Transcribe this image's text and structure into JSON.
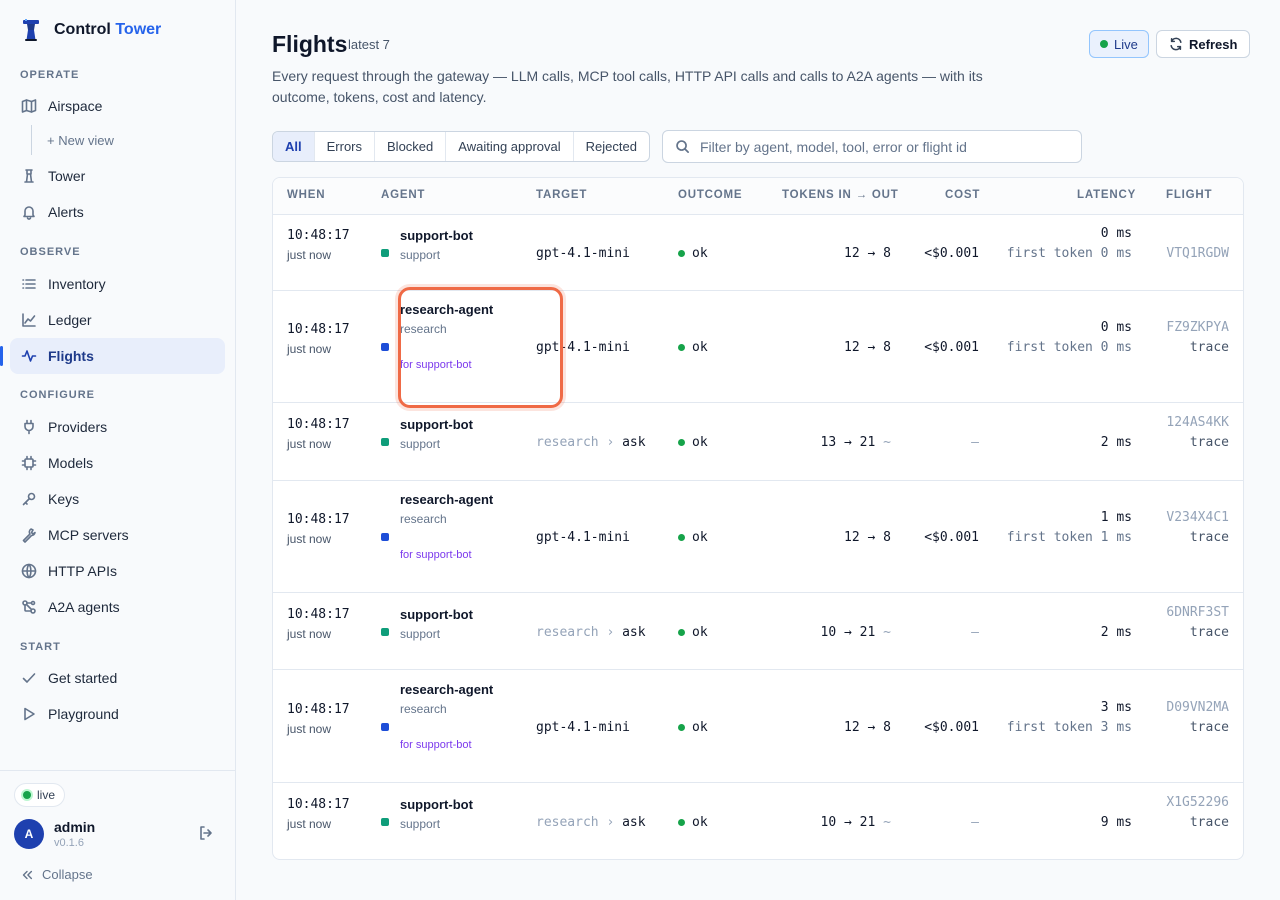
{
  "brand": {
    "name_part1": "Control",
    "name_part2": "Tower"
  },
  "sidebar": {
    "sections": {
      "operate": "OPERATE",
      "observe": "OBSERVE",
      "configure": "CONFIGURE",
      "start": "START"
    },
    "items": {
      "airspace": "Airspace",
      "new_view": "+ New view",
      "tower": "Tower",
      "alerts": "Alerts",
      "inventory": "Inventory",
      "ledger": "Ledger",
      "flights": "Flights",
      "providers": "Providers",
      "models": "Models",
      "keys": "Keys",
      "mcp_servers": "MCP servers",
      "http_apis": "HTTP APIs",
      "a2a_agents": "A2A agents",
      "get_started": "Get started",
      "playground": "Playground"
    },
    "active": "flights",
    "footer": {
      "status": "live",
      "avatar_initial": "A",
      "user": "admin",
      "version": "v0.1.6",
      "collapse": "Collapse"
    }
  },
  "header": {
    "title": "Flights",
    "subtitle": "latest 7",
    "description": "Every request through the gateway — LLM calls, MCP tool calls, HTTP API calls and calls to A2A agents — with its outcome, tokens, cost and latency.",
    "live_label": "Live",
    "refresh_label": "Refresh"
  },
  "filters": {
    "tabs": [
      "All",
      "Errors",
      "Blocked",
      "Awaiting approval",
      "Rejected"
    ],
    "selected": "All",
    "search_placeholder": "Filter by agent, model, tool, error or flight id"
  },
  "table": {
    "columns": [
      "WHEN",
      "AGENT",
      "TARGET",
      "OUTCOME",
      "TOKENS IN → OUT",
      "COST",
      "LATENCY",
      "FLIGHT"
    ],
    "rows": [
      {
        "time": "10:48:17",
        "rel": "just now",
        "agent": "support-bot",
        "team": "support",
        "for": "",
        "swatch": "#0f9d7a",
        "target_prefix": "",
        "target": "gpt-4.1-mini",
        "outcome": "ok",
        "tokens": "12 → 8",
        "tokens_suffix": "",
        "cost": "<$0.001",
        "latency": "0 ms",
        "first_token": "first token 0 ms",
        "flight": "VTQ1RGDW",
        "trace": ""
      },
      {
        "time": "10:48:17",
        "rel": "just now",
        "agent": "research-agent",
        "team": "research",
        "for": "for support-bot",
        "swatch": "#1d4ed8",
        "target_prefix": "",
        "target": "gpt-4.1-mini",
        "outcome": "ok",
        "tokens": "12 → 8",
        "tokens_suffix": "",
        "cost": "<$0.001",
        "latency": "0 ms",
        "first_token": "first token 0 ms",
        "flight": "FZ9ZKPYA",
        "trace": "trace"
      },
      {
        "time": "10:48:17",
        "rel": "just now",
        "agent": "support-bot",
        "team": "support",
        "for": "",
        "swatch": "#0f9d7a",
        "target_prefix": "research ›",
        "target": "ask",
        "outcome": "ok",
        "tokens": "13 → 21",
        "tokens_suffix": "~",
        "cost": "—",
        "latency": "2 ms",
        "first_token": "",
        "flight": "124AS4KK",
        "trace": "trace"
      },
      {
        "time": "10:48:17",
        "rel": "just now",
        "agent": "research-agent",
        "team": "research",
        "for": "for support-bot",
        "swatch": "#1d4ed8",
        "target_prefix": "",
        "target": "gpt-4.1-mini",
        "outcome": "ok",
        "tokens": "12 → 8",
        "tokens_suffix": "",
        "cost": "<$0.001",
        "latency": "1 ms",
        "first_token": "first token 1 ms",
        "flight": "V234X4C1",
        "trace": "trace"
      },
      {
        "time": "10:48:17",
        "rel": "just now",
        "agent": "support-bot",
        "team": "support",
        "for": "",
        "swatch": "#0f9d7a",
        "target_prefix": "research ›",
        "target": "ask",
        "outcome": "ok",
        "tokens": "10 → 21",
        "tokens_suffix": "~",
        "cost": "—",
        "latency": "2 ms",
        "first_token": "",
        "flight": "6DNRF3ST",
        "trace": "trace"
      },
      {
        "time": "10:48:17",
        "rel": "just now",
        "agent": "research-agent",
        "team": "research",
        "for": "for support-bot",
        "swatch": "#1d4ed8",
        "target_prefix": "",
        "target": "gpt-4.1-mini",
        "outcome": "ok",
        "tokens": "12 → 8",
        "tokens_suffix": "",
        "cost": "<$0.001",
        "latency": "3 ms",
        "first_token": "first token 3 ms",
        "flight": "D09VN2MA",
        "trace": "trace"
      },
      {
        "time": "10:48:17",
        "rel": "just now",
        "agent": "support-bot",
        "team": "support",
        "for": "",
        "swatch": "#0f9d7a",
        "target_prefix": "research ›",
        "target": "ask",
        "outcome": "ok",
        "tokens": "10 → 21",
        "tokens_suffix": "~",
        "cost": "—",
        "latency": "9 ms",
        "first_token": "",
        "flight": "X1G52296",
        "trace": "trace"
      }
    ]
  },
  "colors": {
    "accent": "#2563eb",
    "ok": "#16a34a",
    "support": "#0f9d7a",
    "research": "#1d4ed8",
    "delegation": "#7c3aed",
    "highlight": "#ef6a46"
  }
}
